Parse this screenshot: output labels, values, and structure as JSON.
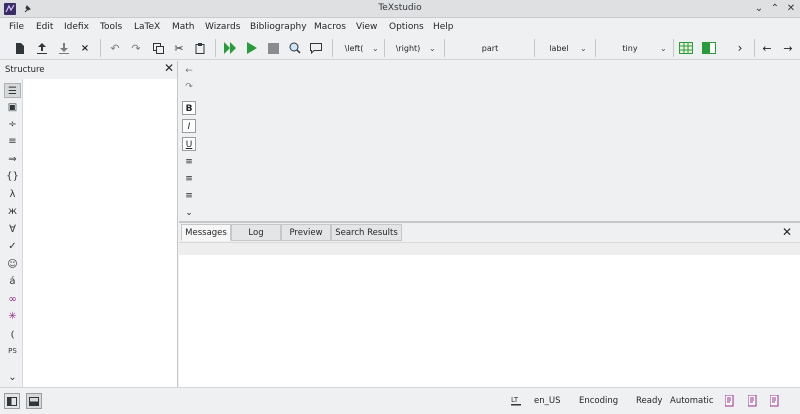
{
  "window": {
    "title": "TeXstudio"
  },
  "menu": [
    "File",
    "Edit",
    "Idefix",
    "Tools",
    "LaTeX",
    "Math",
    "Wizards",
    "Bibliography",
    "Macros",
    "View",
    "Options",
    "Help"
  ],
  "toolbar": {
    "left_delim": "\\left(",
    "right_delim": "\\right)",
    "sectioning": "part",
    "reference": "label",
    "size": "tiny"
  },
  "structure": {
    "title": "Structure"
  },
  "messages": {
    "tabs": [
      "Messages",
      "Log",
      "Preview",
      "Search Results"
    ],
    "active_tab": "Messages"
  },
  "status": {
    "lang": "en_US",
    "encoding": "Encoding",
    "state": "Ready",
    "mode": "Automatic"
  },
  "colors": {
    "accent": "#2a9b3a",
    "math_icon": "#9b2a8f"
  }
}
